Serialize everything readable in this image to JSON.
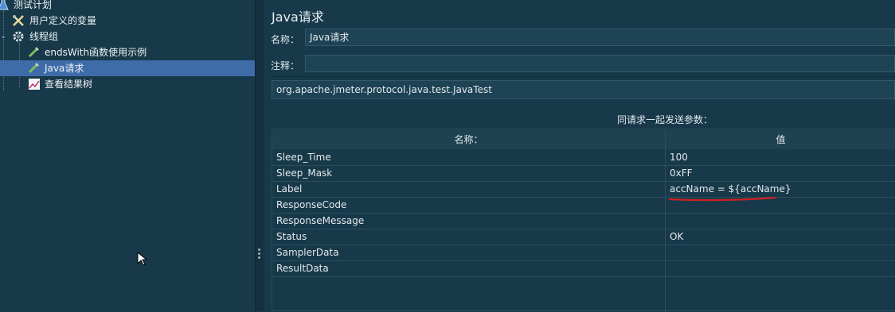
{
  "tree": {
    "items": [
      {
        "label": "测试计划",
        "icon": "flask-icon"
      },
      {
        "label": "用户定义的变量",
        "icon": "tools-icon"
      },
      {
        "label": "线程组",
        "icon": "gear-icon"
      },
      {
        "label": "endsWith函数使用示例",
        "icon": "pipette-icon"
      },
      {
        "label": "Java请求",
        "icon": "pipette-icon"
      },
      {
        "label": "查看结果树",
        "icon": "chart-icon"
      }
    ],
    "selected_index": 4
  },
  "panel": {
    "title": "Java请求",
    "name_label": "名称：",
    "name_value": "Java请求",
    "comment_label": "注释：",
    "comment_value": "",
    "classname": "org.apache.jmeter.protocol.java.test.JavaTest"
  },
  "params": {
    "title": "同请求一起发送参数：",
    "col_name": "名称：",
    "col_value": "值",
    "rows": [
      {
        "name": "Sleep_Time",
        "value": "100"
      },
      {
        "name": "Sleep_Mask",
        "value": "0xFF"
      },
      {
        "name": "Label",
        "value": "accName = ${accName}"
      },
      {
        "name": "ResponseCode",
        "value": ""
      },
      {
        "name": "ResponseMessage",
        "value": ""
      },
      {
        "name": "Status",
        "value": "OK"
      },
      {
        "name": "SamplerData",
        "value": ""
      },
      {
        "name": "ResultData",
        "value": ""
      }
    ]
  },
  "colors": {
    "selection": "#3d6ca9",
    "background": "#17394a",
    "annotation_underline": "#d02020"
  }
}
